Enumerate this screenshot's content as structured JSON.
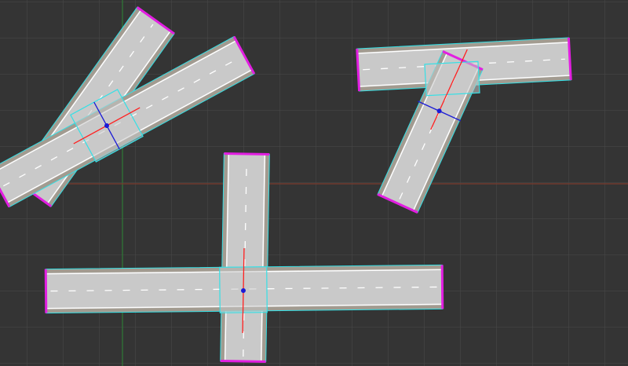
{
  "viewport": {
    "type": "3d-scene-viewport",
    "background_color": "#343434",
    "grid": {
      "visible": true,
      "line_color": "#4a4a4a",
      "axis_x_color": "#7a3b2c",
      "axis_y_color": "#2d7a36"
    }
  },
  "colors": {
    "asphalt": "#c9c9c9",
    "shoulder": "#a29b90",
    "lane_marking": "#ffffff",
    "selection_outline": "#34e0e6",
    "road_end_handle": "#e21ee1",
    "gizmo_red": "#ff2020",
    "gizmo_blue": "#1b1bd6"
  },
  "scene": {
    "road_segments": [
      {
        "id": "road-a",
        "group": "x-crossing"
      },
      {
        "id": "road-b",
        "group": "x-crossing"
      },
      {
        "id": "road-c",
        "group": "t-junction"
      },
      {
        "id": "road-d",
        "group": "t-junction"
      },
      {
        "id": "road-e",
        "group": "plus-crossing"
      },
      {
        "id": "road-f",
        "group": "plus-crossing"
      }
    ],
    "intersections": [
      {
        "id": "intersection-x",
        "type": "x-crossing",
        "selected": true
      },
      {
        "id": "intersection-t",
        "type": "t-junction",
        "selected": true
      },
      {
        "id": "intersection-plus",
        "type": "plus-crossing",
        "selected": true
      }
    ]
  }
}
